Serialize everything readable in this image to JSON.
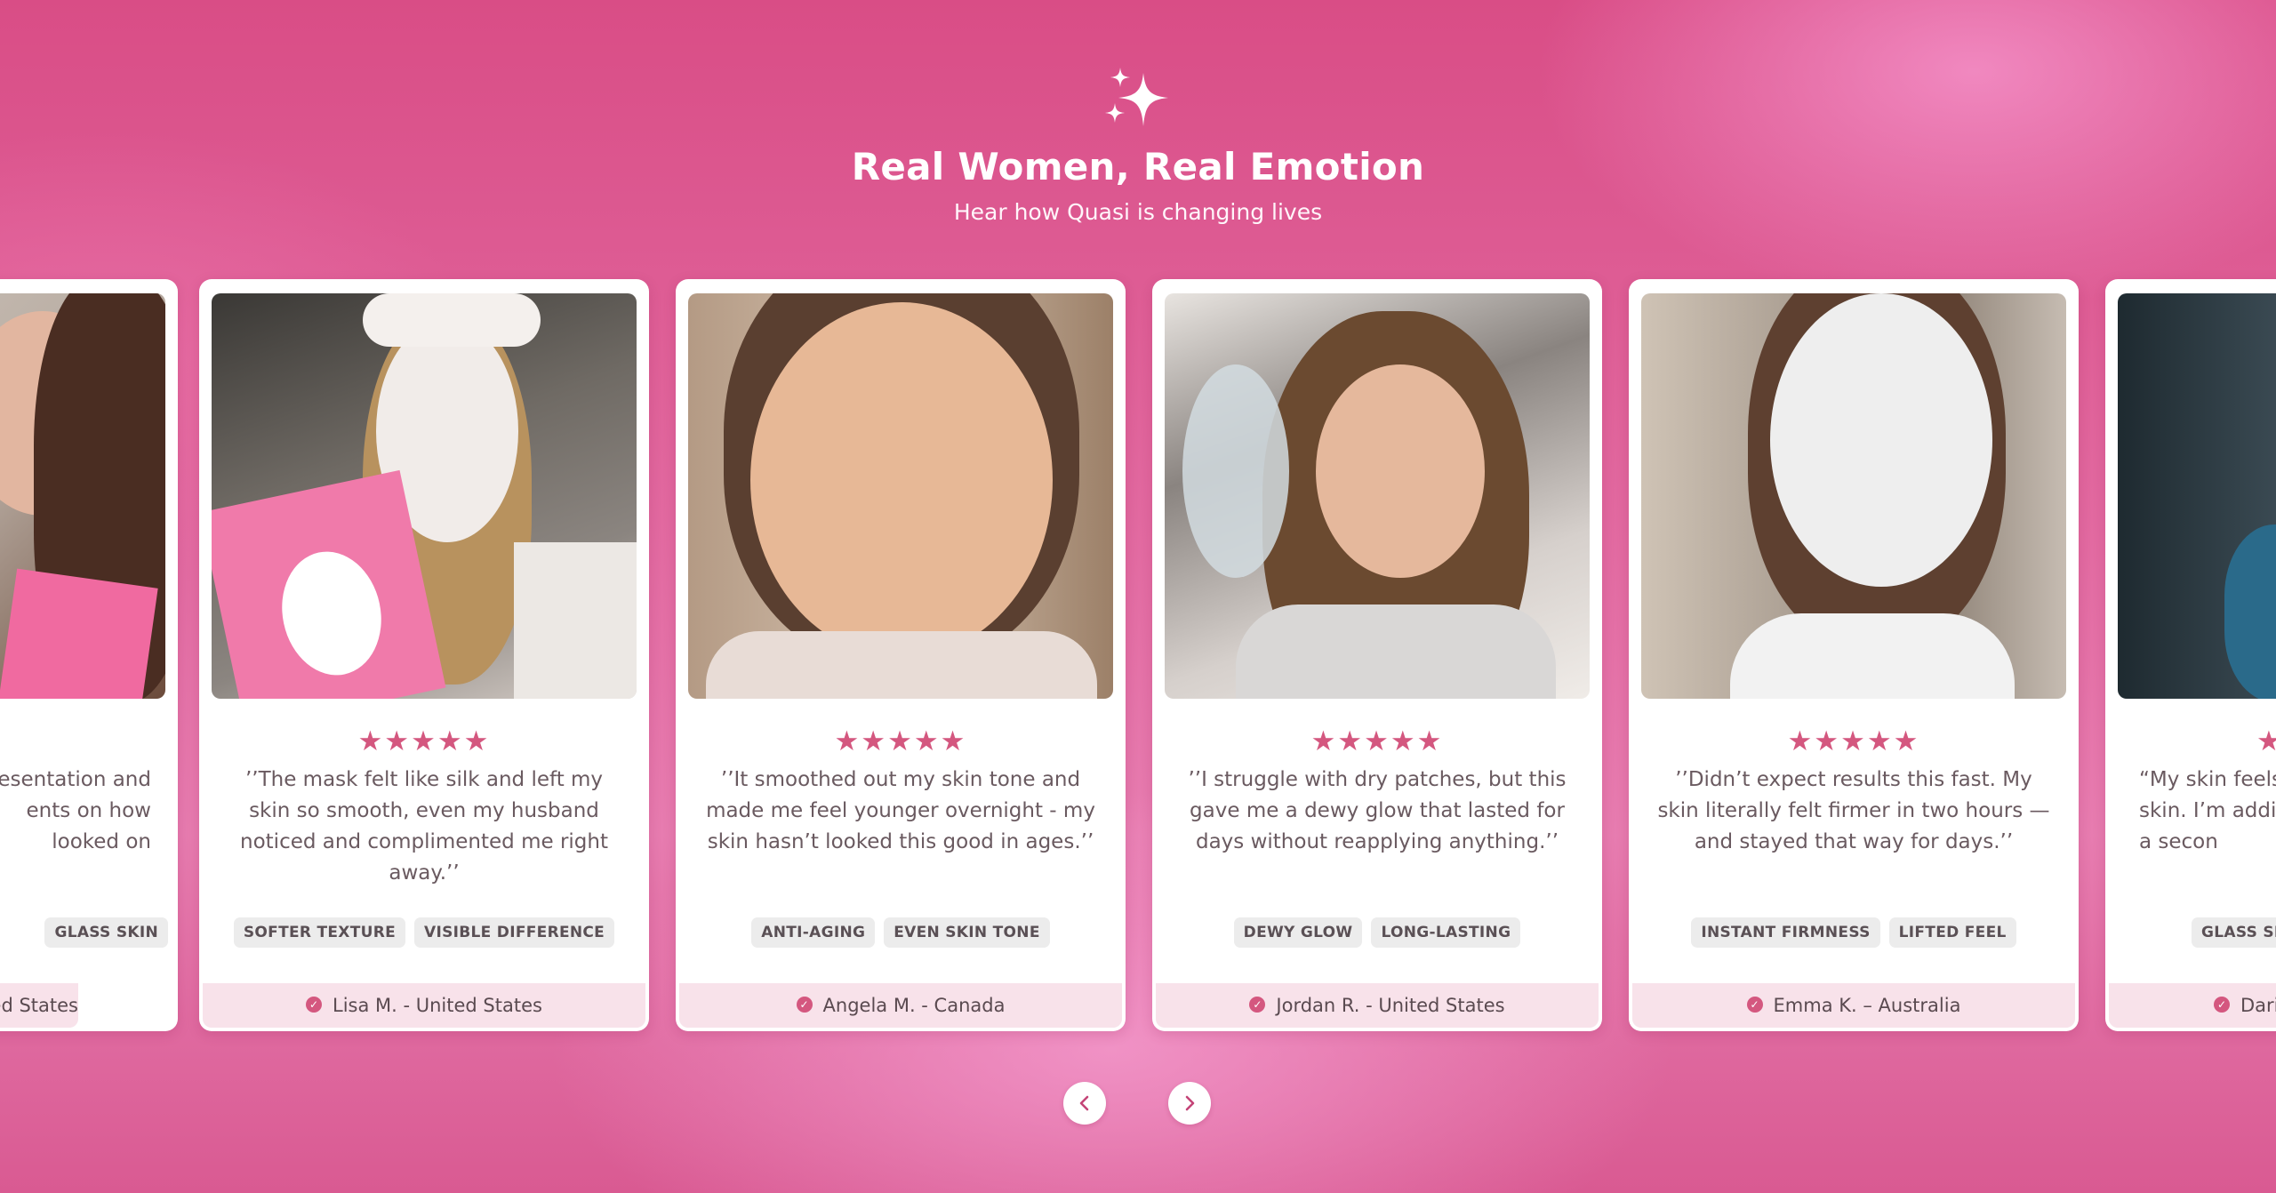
{
  "section": {
    "title": "Real Women, Real Emotion",
    "subtitle": "Hear how Quasi is changing lives"
  },
  "colors": {
    "accent": "#d4577f",
    "background_pink": "#e26aa1",
    "footer_tint": "#f8e2ea"
  },
  "cards": [
    {
      "stars": "★",
      "quote": "esentation and\nents on how\nlooked on",
      "tags": [
        "GLASS SKIN"
      ],
      "reviewer": "ed States"
    },
    {
      "stars": "★★★★★",
      "quote": "’’The mask felt like silk and left my skin so smooth, even my husband noticed and complimented me right away.’’",
      "tags": [
        "SOFTER TEXTURE",
        "VISIBLE DIFFERENCE"
      ],
      "reviewer": "Lisa M. - United States"
    },
    {
      "stars": "★★★★★",
      "quote": "’’It smoothed out my skin tone and made me feel younger overnight - my skin hasn’t looked this good in ages.’’",
      "tags": [
        "ANTI-AGING",
        "EVEN SKIN TONE"
      ],
      "reviewer": "Angela M. - Canada"
    },
    {
      "stars": "★★★★★",
      "quote": "’’I struggle with dry patches, but this gave me a dewy glow that lasted for days without reapplying anything.’’",
      "tags": [
        "DEWY GLOW",
        "LONG-LASTING"
      ],
      "reviewer": "Jordan R. - United States"
    },
    {
      "stars": "★★★★★",
      "quote": "’’Didn’t expect results this fast. My skin literally felt firmer in two hours — and stayed that way for days.’’",
      "tags": [
        "INSTANT FIRMNESS",
        "LIFTED FEEL"
      ],
      "reviewer": "Emma K. – Australia"
    },
    {
      "stars": "★",
      "quote": "“My skin feels\nskin. I’m addic\na secon",
      "tags": [
        "GLASS SK"
      ],
      "reviewer": "Dari"
    }
  ],
  "icons": {
    "sparkle": "sparkle-icon",
    "verified": "check-circle-icon",
    "prev": "chevron-left-icon",
    "next": "chevron-right-icon"
  }
}
